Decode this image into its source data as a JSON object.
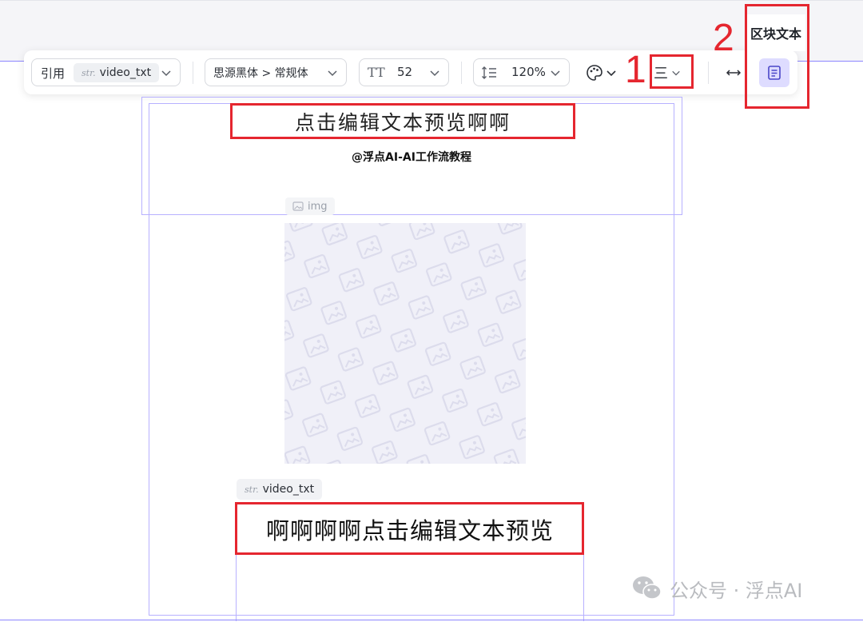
{
  "toolbar": {
    "reference": {
      "label": "引用",
      "chip_prefix": "str.",
      "chip_value": "video_txt"
    },
    "font": {
      "value": "思源黑体 > 常规体"
    },
    "font_size": {
      "icon": "text-size-icon",
      "icon_text": "TT",
      "value": "52"
    },
    "line_height": {
      "icon": "line-height-icon",
      "value": "120%"
    },
    "palette": {
      "icon": "palette-icon"
    },
    "align": {
      "icon": "align-center-icon",
      "glyph": "三"
    },
    "width": {
      "icon": "horizontal-arrows-icon"
    },
    "block_text": {
      "icon": "document-icon",
      "tooltip": "区块文本"
    }
  },
  "annotations": {
    "num1": "1",
    "num2": "2",
    "color": "#e5262f"
  },
  "canvas": {
    "title": "点击编辑文本预览啊啊",
    "subtitle": "@浮点AI-AI工作流教程",
    "img_label": "img",
    "video_label_prefix": "str.",
    "video_label": "video_txt",
    "video_text": "啊啊啊啊点击编辑文本预览"
  },
  "watermark": {
    "icon": "wechat-icon",
    "text": "公众号 · 浮点AI"
  },
  "colors": {
    "guide": "#8c85ff",
    "frame": "#b7b1ff",
    "accent_bg": "#dedcff"
  }
}
